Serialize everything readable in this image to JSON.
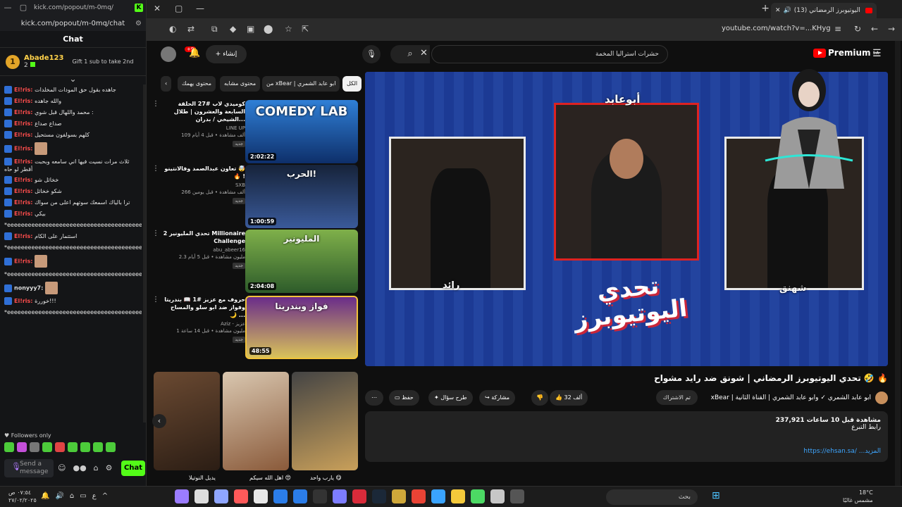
{
  "kick": {
    "titlebar_url": "kick.com/popout/m-0mq/",
    "url": "kick.com/popout/m-0mq/chat",
    "chat_title": "Chat",
    "leader": {
      "rank": "1",
      "name": "Abade123",
      "count": "2",
      "gift": "Gift 1 sub to take 2nd"
    },
    "messages": [
      {
        "user": "El!ris:",
        "text": "جاهده بقول حق المودات المخلدات"
      },
      {
        "user": "El!ris:",
        "text": "والله جاهده"
      },
      {
        "user": "El!ris:",
        "text": "محمد واللهال قبل شوي :"
      },
      {
        "user": "El!ris:",
        "text": "صداع صداع"
      },
      {
        "user": "El!ris:",
        "text": "كلهم بسولفون مستحيل"
      },
      {
        "user": "El!ris:",
        "text": ""
      },
      {
        "user": "El!ris:",
        "text": "ثلاث مرات نسيت فيها اني سامعه وبحبت أقطر لو حاه"
      },
      {
        "user": "El!ris:",
        "text": "خخاثل شو"
      },
      {
        "user": "El!ris:",
        "text": "شكو خخاثل"
      },
      {
        "user": "El!ris:",
        "text": "ترا بالياك اسمعك سوتهم اعلى من سواك"
      },
      {
        "user": "El!ris:",
        "text": "بيكي"
      },
      {
        "user": "",
        "text": "*eeeeeeeeeeeeeeeeeeeeeeeeeeeeeeeeeeeeeeeeeeeeeeeeeeeeeeeee"
      },
      {
        "user": "El!ris:",
        "text": "استتمار على الكام"
      },
      {
        "user": "",
        "text": "*eeeeeeeeeeeeeeeeeeeeeeeeeeeeeeeeeeeeeeeeeeeeeeeeeeeeeeeee"
      },
      {
        "user": "El!ris:",
        "text": ""
      },
      {
        "user": "",
        "text": "*eeeeeeeeeeeeeeeeeeeeeeeeeeeeeeeeeeeeeeeeeeeeeeeeeeeeeeeee"
      },
      {
        "user": "nonyyy7:",
        "text": ""
      },
      {
        "user": "El!ris:",
        "text": "خوررة!!!"
      },
      {
        "user": "",
        "text": "*eeeeeeeeeeeeeeeeeeeeeeeeeeeeeeeeeeeeeeeeeeeeeeeeeeeeeeeee"
      }
    ],
    "followers_only": "Followers only",
    "input_placeholder": "Send a message",
    "chat_button": "Chat"
  },
  "browser": {
    "tab_title": "(13) تحدي اليوتيوبرز الرمضاني",
    "url": "youtube.com/watch?v=...KHyg"
  },
  "youtube": {
    "search_value": "حشرات استراليا المخمة",
    "create_label": "إنشاء",
    "notif_count": "+9",
    "logo": "Premium",
    "logo_region": "SA",
    "player": {
      "label_left": "رائد",
      "label_center": "أبوعابد",
      "label_right": "شهنق",
      "title_art": "تحدي اليوتيوبرز"
    },
    "video_title": "تحدي اليوتيوبرز الرمضاني | شونق ضد رايد مشواح 🤣 🔥",
    "channel": "xBear | ابو عابد الشمري ✓ وابو عابد الشمري | القناة الثانية",
    "subscribed": "تم الاشتراك",
    "likes": "32 ألف",
    "share": "مشاركة",
    "ask": "طرح سؤال",
    "save": "حفظ",
    "description": {
      "views": "237,921 مشاهدة قبل 10 ساعات",
      "line2": "رابط التبرع",
      "link": "https://ehsan.sa/ ...المزيد"
    },
    "chips": [
      "الكل",
      "من xBear | ابو عابد الشمري",
      "محتوى مشابه",
      "محتوى يهمك"
    ],
    "recommendations": [
      {
        "title": "كوميدي لاب #27 الحلقة السابعة والعشرون | طلال الشيخي / بدران...",
        "channel": "LINE UP",
        "stats": "109 ألف مشاهدة • قبل 4 أيام",
        "badge": "جديد",
        "duration": "2:02:22",
        "thumb_text": "COMEDY LAB"
      },
      {
        "title": "تعاون عبدالصمد وفالانتينو 🤯 🔥 !",
        "channel": "SXB",
        "stats": "266 ألف مشاهدة • قبل يومين",
        "badge": "جديد",
        "duration": "1:00:59",
        "thumb_text": "الحرب!"
      },
      {
        "title": "تحدي المليونير 2 Millionaire Challenge",
        "channel": "abu_abeer16",
        "stats": "2.3 مليون مشاهدة • قبل 5 أيام",
        "badge": "جديد",
        "duration": "2:04:08",
        "thumb_text": "المليونير"
      },
      {
        "title": "حروف مع عزيز #1 📖 بندريتا وفواز ضد ابو سلو والمساح 🌙 ...",
        "channel": "Aziz - عزيز",
        "stats": "1 مليون مشاهدة • قبل 14 ساعة",
        "badge": "جديد",
        "duration": "48:55",
        "thumb_text": "فواز وبندريتا"
      }
    ],
    "shorts_titles": [
      "يديل النوتيلا",
      "اهل الله سيكم 😍",
      "يارب واحد 😋"
    ]
  },
  "taskbar": {
    "time": "٠٧:٥٤ ص",
    "date": "٢٧/٠٢/٢٠٢٥",
    "search": "بحث",
    "temp": "18°C",
    "weather": "مشمس غالبًا",
    "lang": "ع"
  }
}
